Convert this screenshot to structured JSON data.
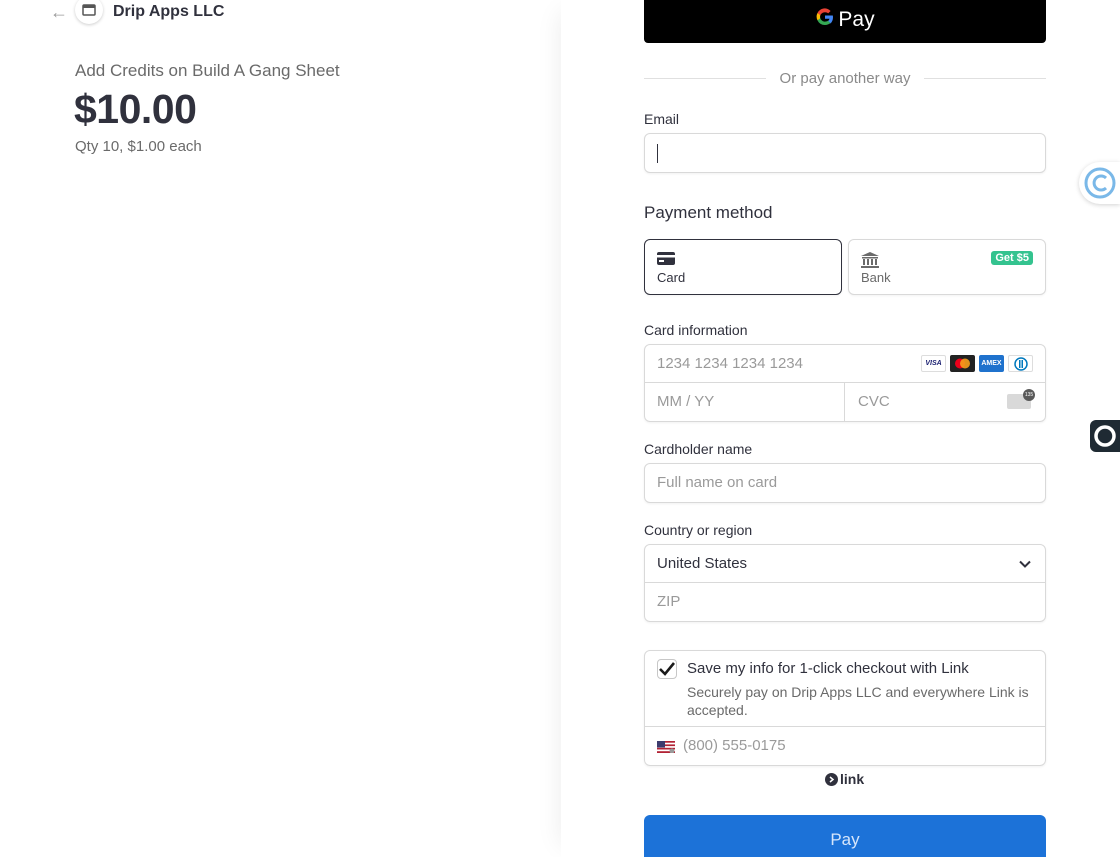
{
  "merchant": {
    "name": "Drip Apps LLC"
  },
  "summary": {
    "product": "Add Credits on Build A Gang Sheet",
    "price": "$10.00",
    "quantity": "Qty 10, $1.00 each"
  },
  "gpay": {
    "label": "Pay",
    "brand": "G"
  },
  "divider": "Or pay another way",
  "email": {
    "label": "Email",
    "value": ""
  },
  "payment_method": {
    "title": "Payment method",
    "options": [
      {
        "label": "Card",
        "icon": "card-icon",
        "selected": true
      },
      {
        "label": "Bank",
        "icon": "bank-icon",
        "badge": "Get $5",
        "selected": false
      }
    ]
  },
  "card": {
    "label": "Card information",
    "number_placeholder": "1234 1234 1234 1234",
    "expiry_placeholder": "MM / YY",
    "cvc_placeholder": "CVC",
    "brands": [
      "VISA",
      "Mastercard",
      "AMEX",
      "Diners"
    ]
  },
  "cardholder": {
    "label": "Cardholder name",
    "placeholder": "Full name on card"
  },
  "country": {
    "label": "Country or region",
    "value": "United States",
    "zip_placeholder": "ZIP"
  },
  "link": {
    "checked": true,
    "title": "Save my info for 1-click checkout with Link",
    "description": "Securely pay on Drip Apps LLC and everywhere Link is accepted.",
    "phone_placeholder": "(800) 555-0175",
    "logo_text": "link"
  },
  "pay_button": "Pay",
  "colors": {
    "pay_button": "#1c72d8",
    "badge": "#34c38f",
    "text": "#30313d"
  }
}
